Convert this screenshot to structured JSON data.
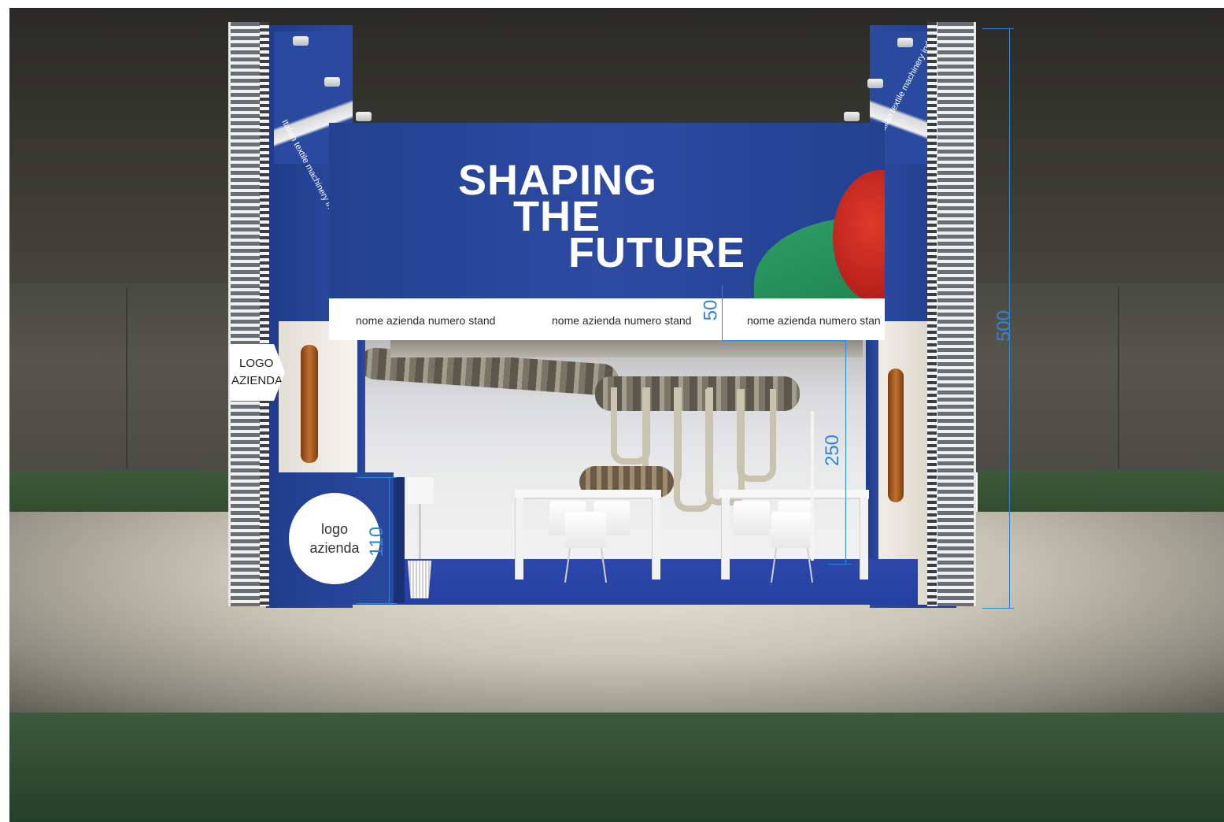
{
  "banner": {
    "slogan_line1": "SHAPING",
    "slogan_line2": "THE",
    "slogan_line3": "FUTURE"
  },
  "name_band": {
    "items": [
      "nome azienda numero stand",
      "nome azienda numero stand",
      "nome azienda numero stan"
    ]
  },
  "side_fascia": {
    "left_text": "Italian textile machinery industry",
    "right_text": "Italian textile machinery industry"
  },
  "logo_sign": {
    "line1": "LOGO",
    "line2": "AZIENDA"
  },
  "counter_logo": {
    "line1": "logo",
    "line2": "azienda"
  },
  "dimensions": {
    "total_height": "500",
    "fascia_height": "50",
    "inner_height": "250",
    "counter_height": "110"
  },
  "colors": {
    "booth_blue": "#2a489e",
    "dimension_blue": "#2f84d6",
    "accent_red": "#d23a2a",
    "accent_green": "#2fa066"
  }
}
